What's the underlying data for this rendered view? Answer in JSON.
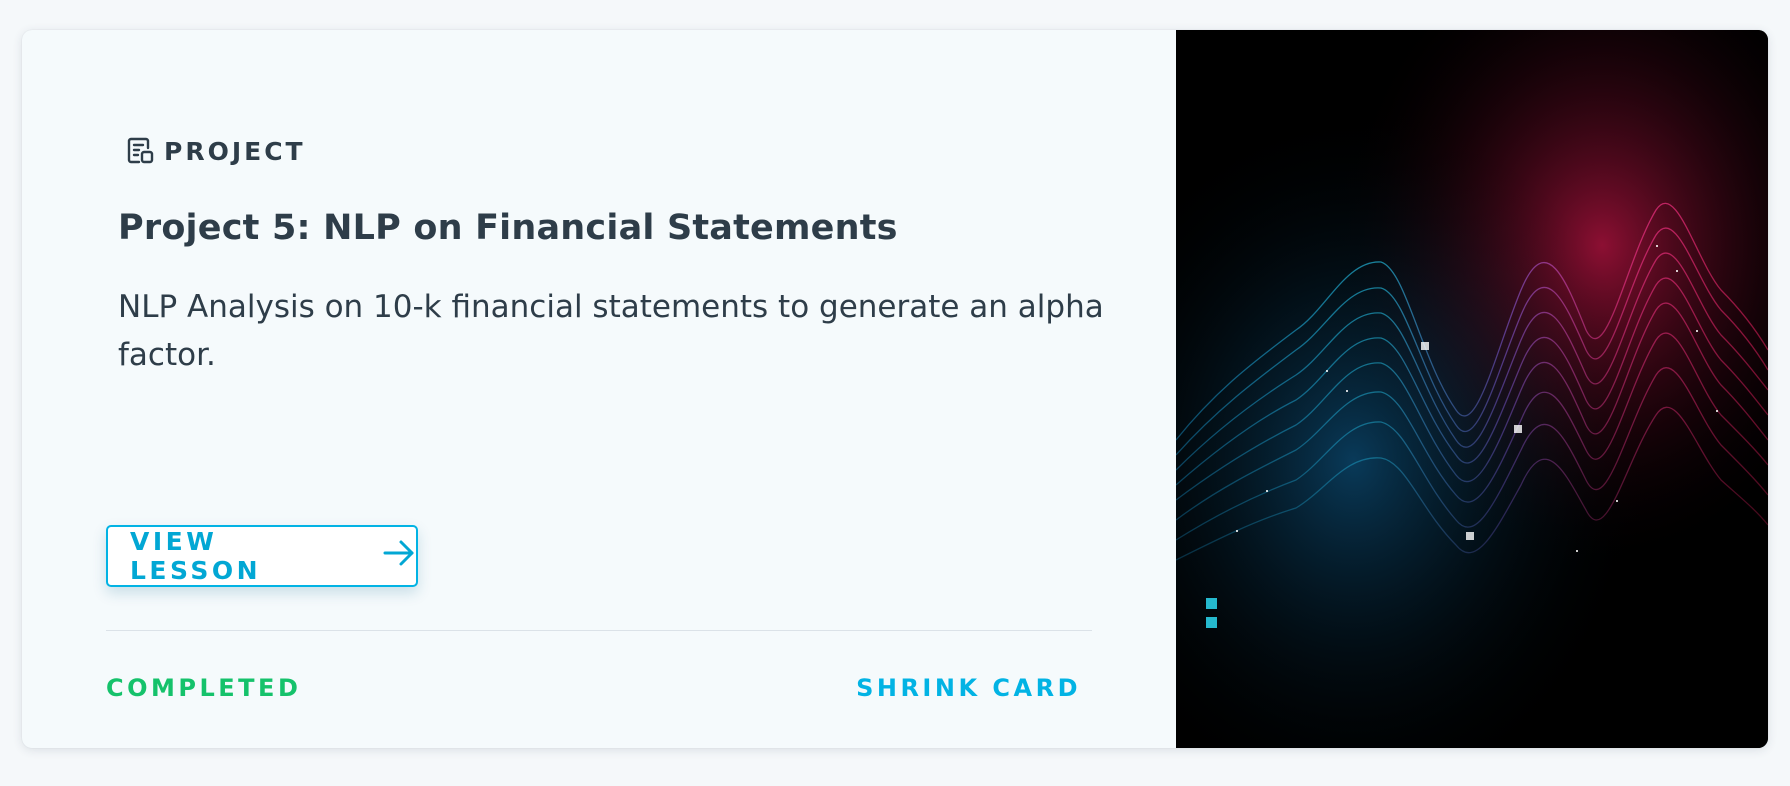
{
  "card": {
    "type_label": "PROJECT",
    "type_icon": "project-icon",
    "title": "Project 5: NLP on Financial Statements",
    "description": "NLP Analysis on 10-k financial statements to generate an alpha factor.",
    "primary_action": {
      "label": "VIEW LESSON",
      "icon": "arrow-right-icon"
    },
    "status": "COMPLETED",
    "secondary_action": "SHRINK CARD",
    "colors": {
      "accent": "#02b3e4",
      "completed": "#15c26b",
      "text": "#2e3d49"
    }
  }
}
